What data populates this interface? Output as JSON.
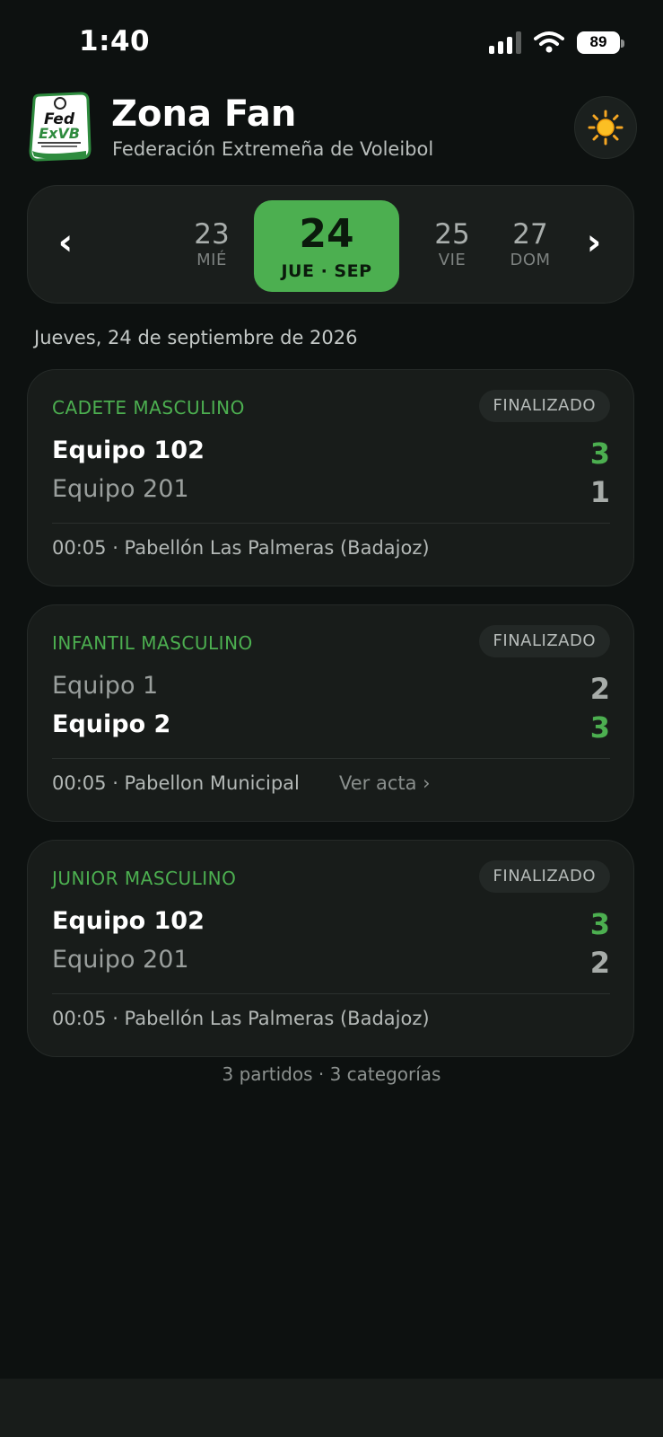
{
  "status_bar": {
    "time": "1:40",
    "battery": "89"
  },
  "header": {
    "logo_text": "Fed ExVB",
    "title": "Zona Fan",
    "subtitle": "Federación Extremeña de Voleibol",
    "theme_icon": "sun-icon"
  },
  "date_nav": {
    "prev_label": "‹",
    "next_label": "›",
    "days": [
      {
        "num": "23",
        "label": "MIÉ"
      },
      {
        "num": "24",
        "label": "JUE · SEP",
        "selected": true
      },
      {
        "num": "25",
        "label": "VIE"
      },
      {
        "num": "27",
        "label": "DOM"
      }
    ]
  },
  "date_heading": "Jueves, 24 de septiembre de 2026",
  "matches": [
    {
      "category": "CADETE MASCULINO",
      "status": "FINALIZADO",
      "home": {
        "name": "Equipo 102",
        "score": "3",
        "winner": true
      },
      "away": {
        "name": "Equipo 201",
        "score": "1",
        "winner": false
      },
      "meta": "00:05 · Pabellón Las Palmeras (Badajoz)"
    },
    {
      "category": "INFANTIL MASCULINO",
      "status": "FINALIZADO",
      "home": {
        "name": "Equipo 1",
        "score": "2",
        "winner": false
      },
      "away": {
        "name": "Equipo 2",
        "score": "3",
        "winner": true
      },
      "meta": "00:05 · Pabellon  Municipal",
      "link": "Ver acta ›"
    },
    {
      "category": "JUNIOR MASCULINO",
      "status": "FINALIZADO",
      "home": {
        "name": "Equipo 102",
        "score": "3",
        "winner": true
      },
      "away": {
        "name": "Equipo 201",
        "score": "2",
        "winner": false
      },
      "meta": "00:05 · Pabellón Las Palmeras (Badajoz)"
    }
  ],
  "summary": "3 partidos · 3 categorías",
  "colors": {
    "accent": "#4caf50",
    "background": "#0d1110",
    "card": "#181c1a"
  }
}
